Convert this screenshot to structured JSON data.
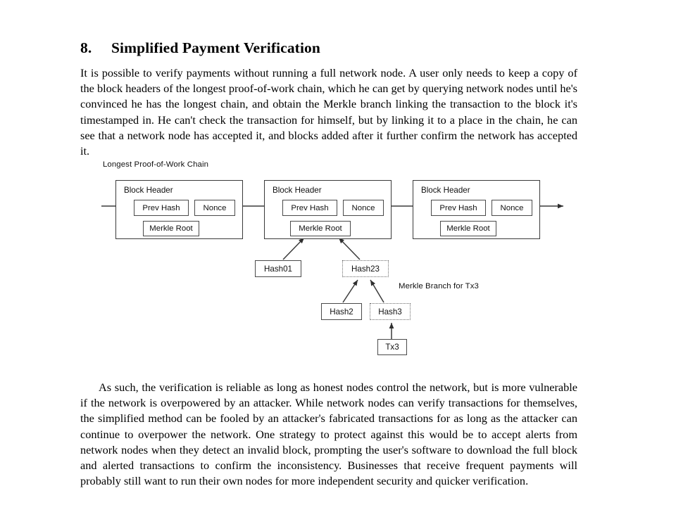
{
  "document": {
    "section_number": "8.",
    "section_title": "Simplified Payment Verification",
    "paragraph_intro": "It is possible to verify payments without running a full network node.  A user only needs to keep a copy of the block headers of the longest proof-of-work chain, which he can get by querying network nodes until he's convinced he has the longest chain, and obtain the Merkle branch linking the transaction to the block it's timestamped in.  He can't check the transaction for himself, but by linking it to a place in the chain, he can see that a network node has accepted it, and blocks added after it further confirm the network has accepted it.",
    "paragraph_closing": "As such, the verification is reliable as long as honest nodes control the network, but is more vulnerable if the network is overpowered by an attacker.  While network nodes can verify transactions for themselves, the simplified method can be fooled by an attacker's fabricated transactions for as long as the attacker can continue to overpower the network.  One strategy to protect against this would be to accept alerts from network nodes when they detect an invalid block, prompting the user's software to download the full block and alerted transactions to confirm the inconsistency.  Businesses that receive frequent payments will probably still want to run their own nodes for more independent security and quicker verification."
  },
  "figure": {
    "chain_label": "Longest Proof-of-Work Chain",
    "branch_label": "Merkle Branch for Tx3",
    "blocks": [
      {
        "title": "Block Header",
        "prev_hash": "Prev Hash",
        "nonce": "Nonce",
        "merkle_root": "Merkle Root"
      },
      {
        "title": "Block Header",
        "prev_hash": "Prev Hash",
        "nonce": "Nonce",
        "merkle_root": "Merkle Root"
      },
      {
        "title": "Block Header",
        "prev_hash": "Prev Hash",
        "nonce": "Nonce",
        "merkle_root": "Merkle Root"
      }
    ],
    "tree_nodes": [
      {
        "label": "Hash01",
        "border": "solid"
      },
      {
        "label": "Hash23",
        "border": "dashed"
      },
      {
        "label": "Hash2",
        "border": "solid"
      },
      {
        "label": "Hash3",
        "border": "dashed"
      },
      {
        "label": "Tx3",
        "border": "solid"
      }
    ],
    "colors": {
      "line": "#3a3a3a",
      "text": "#111111",
      "background": "#ffffff"
    }
  }
}
